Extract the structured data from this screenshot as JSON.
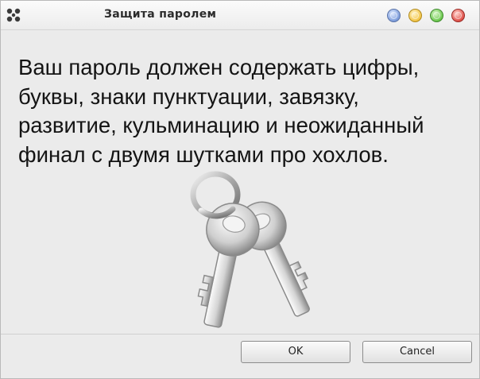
{
  "window": {
    "title": "Защита паролем",
    "menu_icon": "app-menu-icon",
    "controls": [
      "help-icon",
      "minimize-icon",
      "maximize-icon",
      "close-icon"
    ]
  },
  "dialog": {
    "message": "Ваш пароль должен содержать цифры,\nбуквы, знаки пунктуации, завязку,\nразвитие, кульминацию и неожиданный\nфинал с двумя шутками про хохлов.",
    "illustration_icon": "keys-icon"
  },
  "buttons": {
    "ok_label": "OK",
    "cancel_label": "Cancel"
  }
}
